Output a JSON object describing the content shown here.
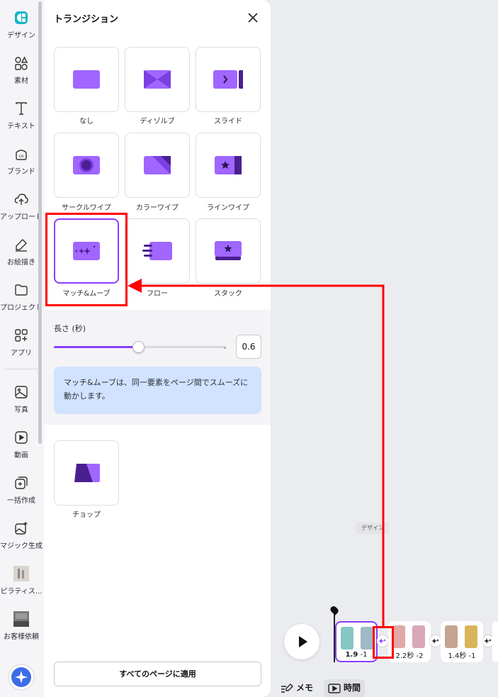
{
  "rail": {
    "items": [
      {
        "label": "デザイン",
        "icon": "design-icon"
      },
      {
        "label": "素材",
        "icon": "elements-icon"
      },
      {
        "label": "テキスト",
        "icon": "text-icon"
      },
      {
        "label": "ブランド",
        "icon": "brand-icon"
      },
      {
        "label": "アップロード",
        "icon": "upload-icon"
      },
      {
        "label": "お絵描き",
        "icon": "draw-icon"
      },
      {
        "label": "プロジェクト",
        "icon": "folder-icon"
      },
      {
        "label": "アプリ",
        "icon": "apps-icon"
      },
      {
        "label": "写真",
        "icon": "photo-icon"
      },
      {
        "label": "動画",
        "icon": "video-icon"
      },
      {
        "label": "一括作成",
        "icon": "bulk-create-icon"
      },
      {
        "label": "マジック生成",
        "icon": "magic-media-icon"
      },
      {
        "label": "ピラティス...",
        "icon": "pilates-thumbnail"
      },
      {
        "label": "お客様依頼",
        "icon": "customer-request-thumbnail"
      }
    ]
  },
  "panel": {
    "title": "トランジション",
    "transitions": [
      {
        "label": "なし",
        "icon": "none-icon"
      },
      {
        "label": "ディゾルブ",
        "icon": "dissolve-icon"
      },
      {
        "label": "スライド",
        "icon": "slide-icon"
      },
      {
        "label": "サークルワイプ",
        "icon": "circle-wipe-icon"
      },
      {
        "label": "カラーワイプ",
        "icon": "color-wipe-icon"
      },
      {
        "label": "ラインワイプ",
        "icon": "line-wipe-icon"
      },
      {
        "label": "マッチ&ムーブ",
        "icon": "match-move-icon",
        "selected": true
      },
      {
        "label": "フロー",
        "icon": "flow-icon"
      },
      {
        "label": "スタック",
        "icon": "stack-icon"
      }
    ],
    "duration": {
      "label": "長さ (秒)",
      "value": "0.6",
      "fraction": 0.49
    },
    "info": "マッチ&ムーブは、同一要素をページ間でスムーズに動かします。",
    "extra": [
      {
        "label": "チョップ",
        "icon": "chop-icon"
      }
    ],
    "apply_all": "すべてのページに適用"
  },
  "timeline": {
    "tooltip": "デザイン",
    "pages": [
      {
        "duration_num": "1.9",
        "duration_rest": " -1"
      },
      {
        "duration_num": "2.2秒",
        "duration_rest": " -2"
      },
      {
        "duration_num": "1.4秒",
        "duration_rest": " -1"
      }
    ],
    "notes": "メモ",
    "time": "時間"
  },
  "colors": {
    "accent": "#8b3dff",
    "tile": "#a066ff",
    "dark": "#5b2bb5",
    "info_bg": "#d1e3ff",
    "highlight": "#ff0000"
  }
}
